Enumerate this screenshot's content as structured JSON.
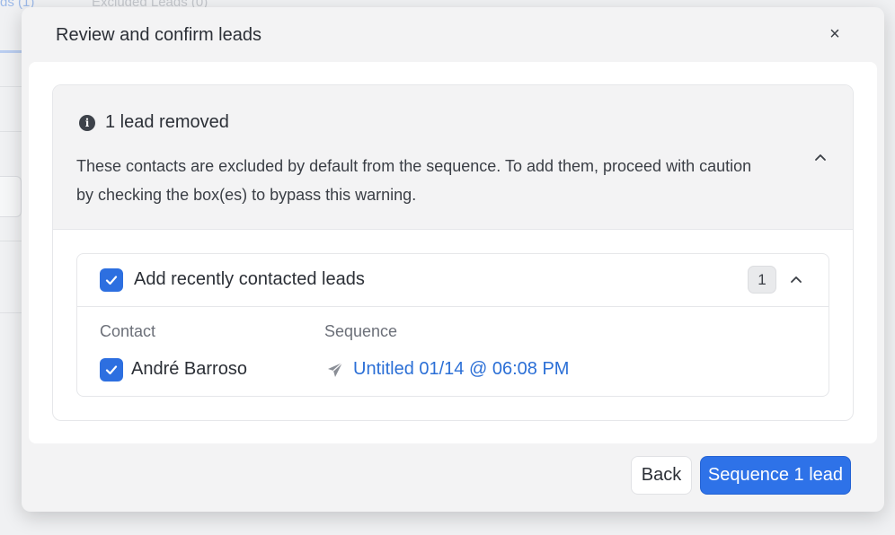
{
  "background": {
    "tab_left": "ds (1)",
    "tab_right": "Excluded Leads (0)"
  },
  "modal": {
    "title": "Review and confirm leads",
    "close_glyph": "×",
    "warning": {
      "icon": "info-icon",
      "title": "1 lead removed",
      "description": "These contacts are excluded by default from the sequence. To add them, proceed with caution by checking the box(es) to bypass this warning.",
      "expanded": true
    },
    "group": {
      "label": "Add recently contacted leads",
      "checked": true,
      "count": "1",
      "columns": {
        "contact": "Contact",
        "sequence": "Sequence"
      },
      "rows": [
        {
          "checked": true,
          "contact": "André Barroso",
          "sequence_icon": "send-icon",
          "sequence": "Untitled 01/14 @ 06:08 PM"
        }
      ]
    },
    "footer": {
      "back_label": "Back",
      "primary_label": "Sequence 1 lead"
    }
  },
  "colors": {
    "accent": "#2e72e8",
    "link": "#2b6fd6",
    "checkbox": "#2d6fe0"
  }
}
